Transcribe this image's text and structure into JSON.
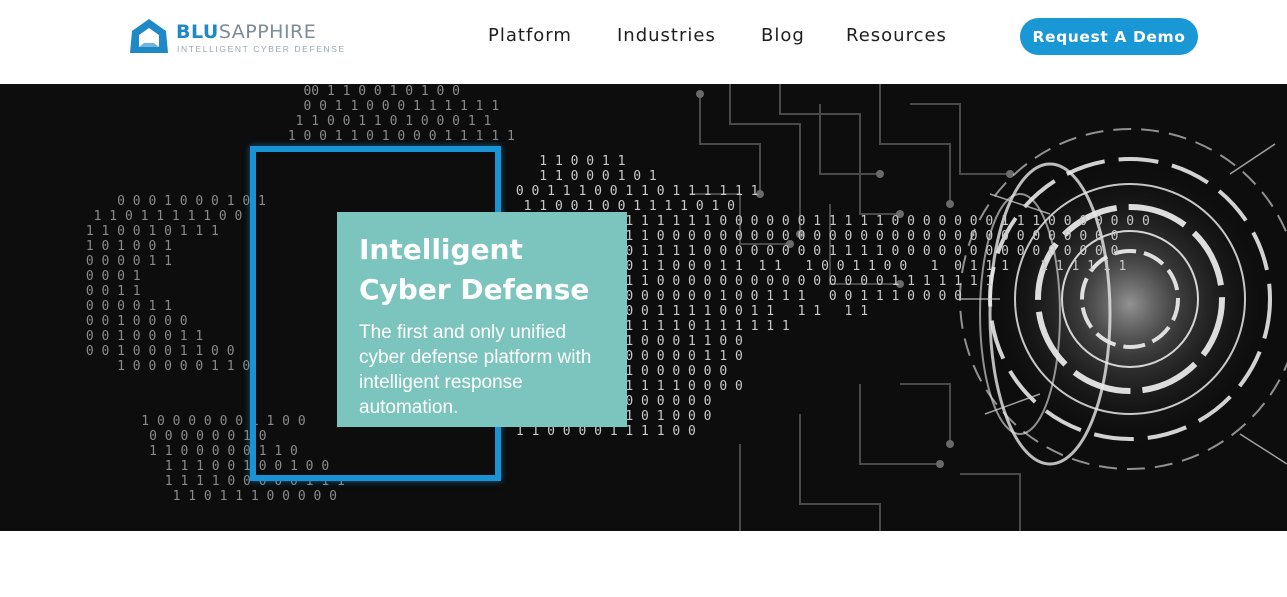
{
  "header": {
    "logo": {
      "brand_primary": "BLU",
      "brand_secondary": "SAPPHIRE",
      "tagline": "INTELLIGENT CYBER DEFENSE",
      "icon": "blusapphire-logo-icon"
    },
    "nav": [
      {
        "label": "Platform"
      },
      {
        "label": "Industries"
      },
      {
        "label": "Blog"
      },
      {
        "label": "Resources"
      }
    ],
    "cta_label": "Request A Demo"
  },
  "hero": {
    "title_line1": "Intelligent",
    "title_line2": "Cyber Defense",
    "description": "The first and only unified cyber defense platform with intelligent response automation."
  },
  "colors": {
    "brand_blue": "#1a97d5",
    "teal_card": "#7cc5bf",
    "hero_background": "#0d0d0d"
  }
}
